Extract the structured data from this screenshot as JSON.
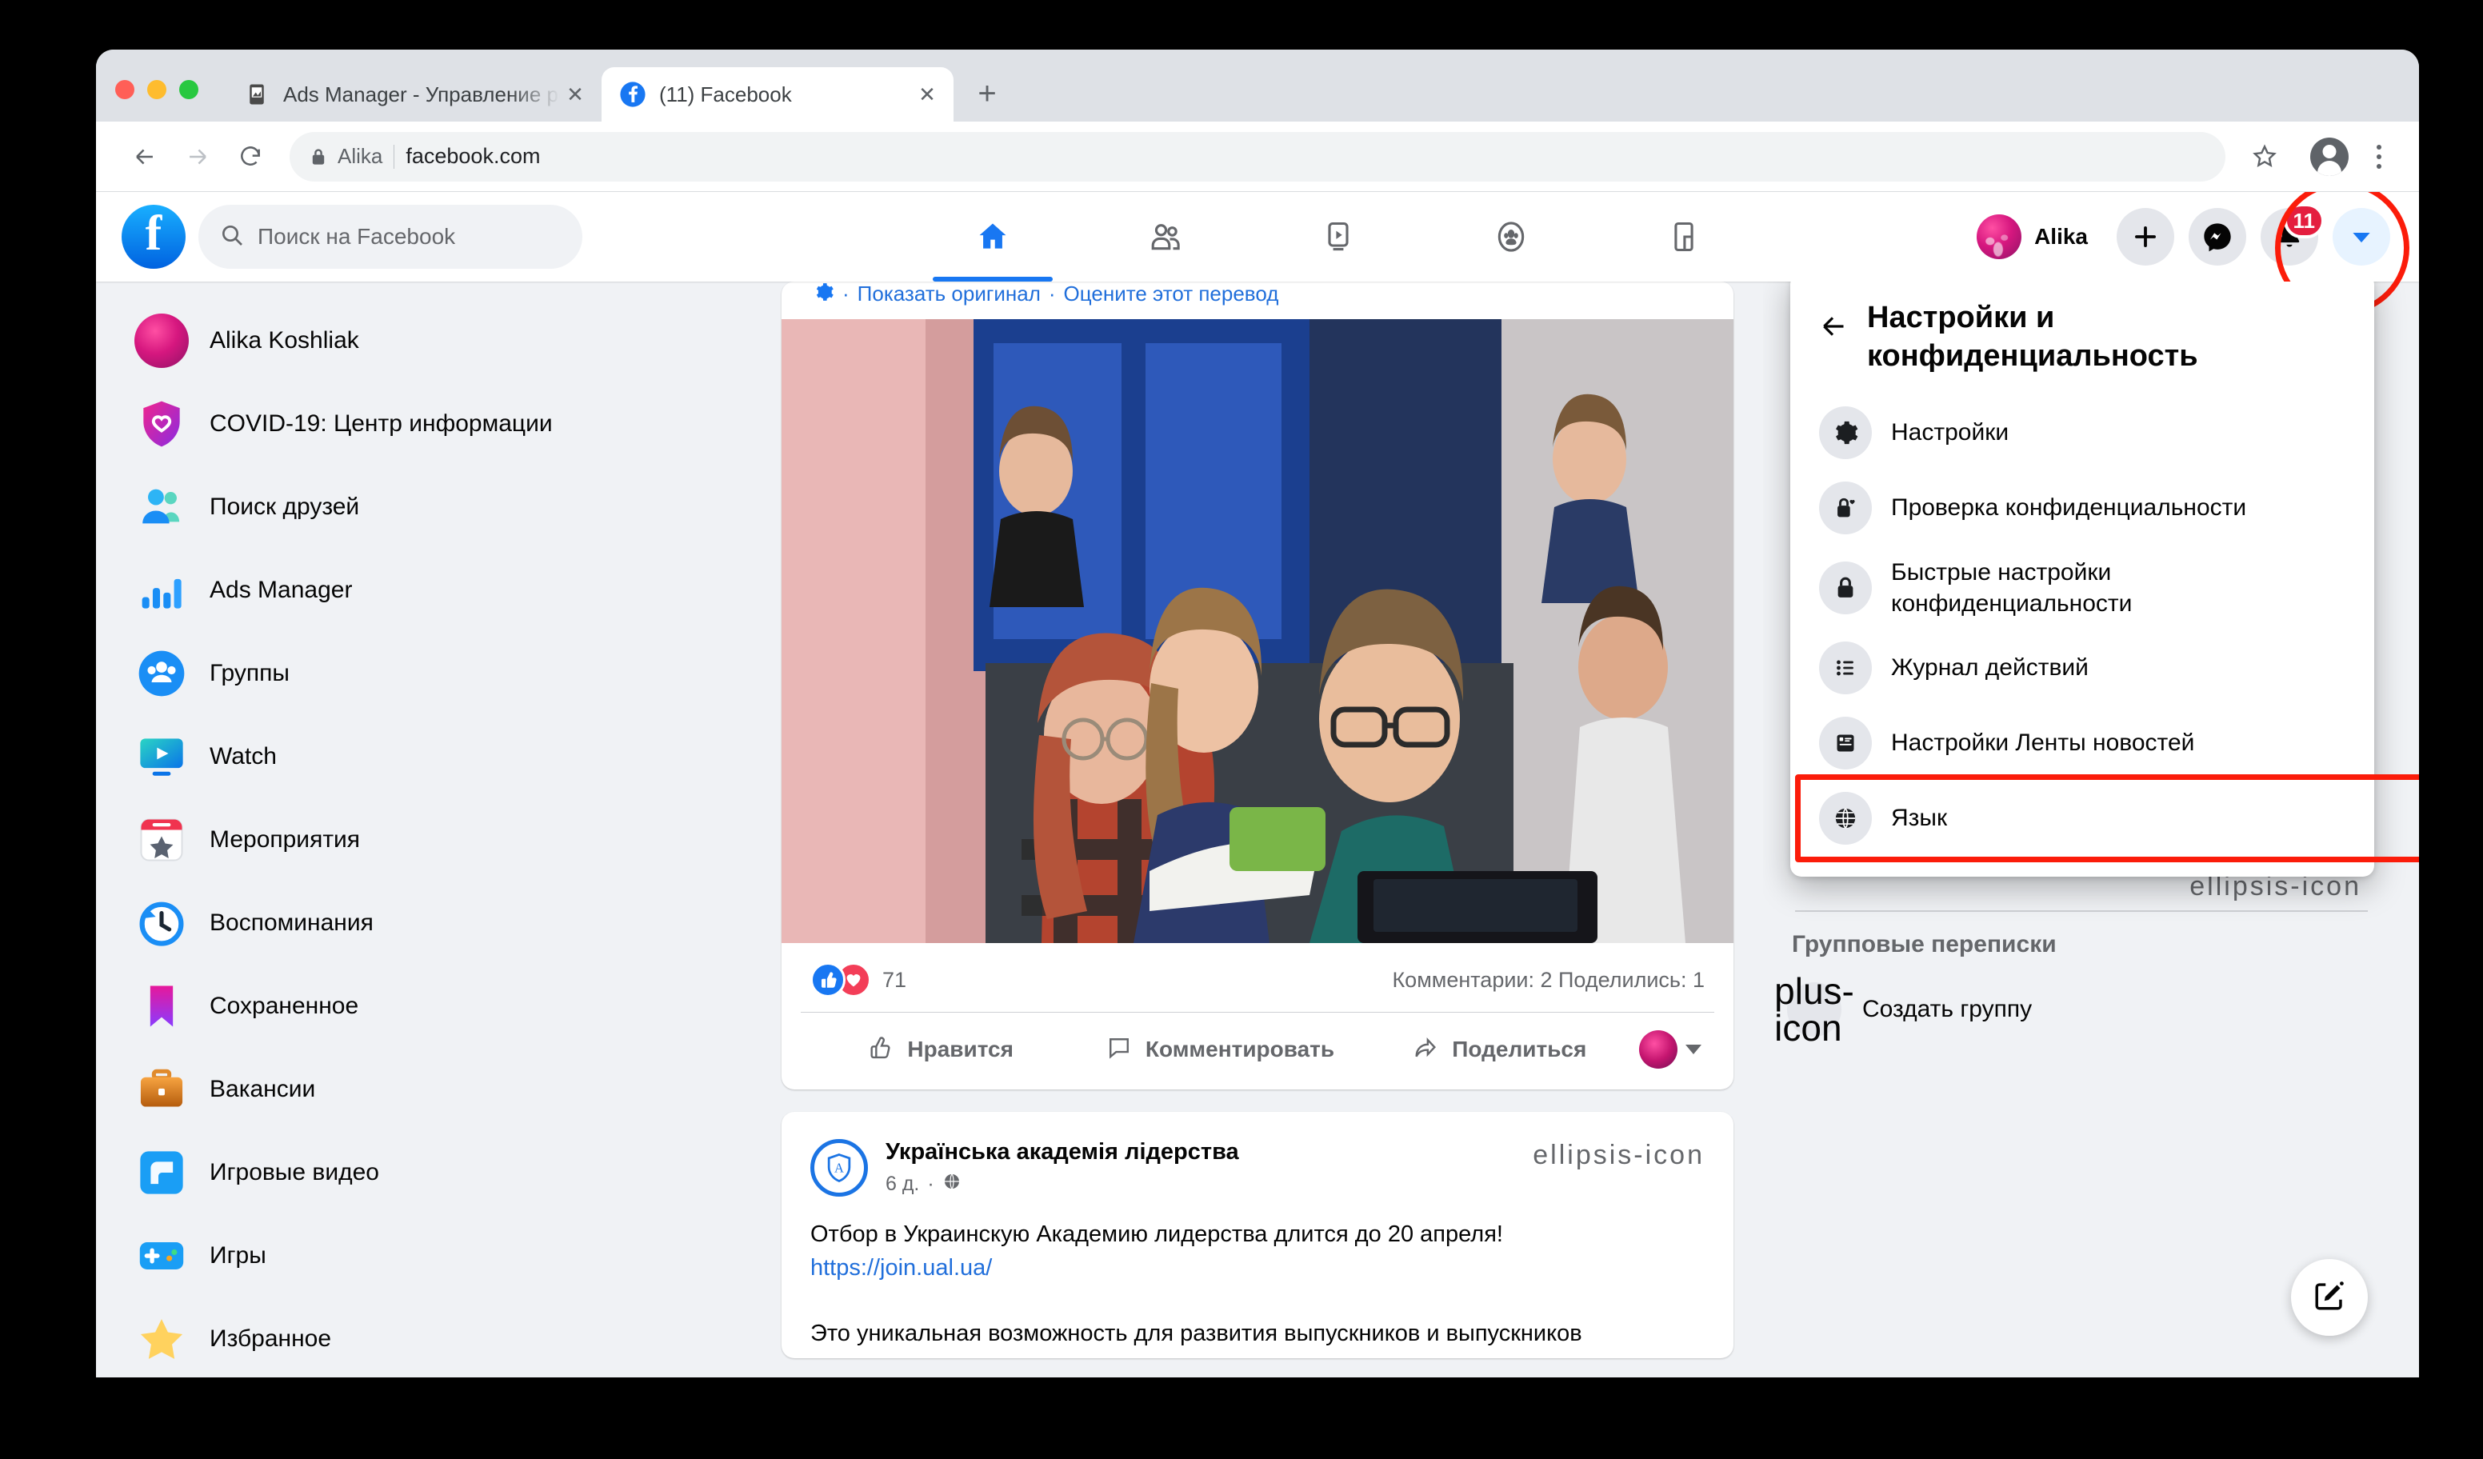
{
  "browser": {
    "tabs": [
      {
        "title": "Ads Manager - Управление ре",
        "favicon": "ads-manager-icon",
        "active": false
      },
      {
        "title": "(11) Facebook",
        "favicon": "facebook-icon",
        "active": true
      }
    ],
    "new_tab_label": "+",
    "close_label": "✕",
    "omnibox": {
      "user": "Alika",
      "url": "facebook.com",
      "lock_icon": "lock-icon"
    },
    "back_label": "←",
    "forward_label": "→",
    "reload_label": "⟳"
  },
  "fb_header": {
    "search_placeholder": "Поиск на Facebook",
    "logo_letter": "f",
    "nav": [
      {
        "name": "home",
        "icon": "home-icon",
        "active": true
      },
      {
        "name": "friends",
        "icon": "friends-icon",
        "active": false
      },
      {
        "name": "watch",
        "icon": "watch-icon",
        "active": false
      },
      {
        "name": "groups",
        "icon": "groups-icon",
        "active": false
      },
      {
        "name": "gaming",
        "icon": "gaming-icon",
        "active": false
      }
    ],
    "user_name": "Alika",
    "create_label": "+",
    "messenger_icon": "messenger-icon",
    "notifications_icon": "bell-icon",
    "notifications_badge": "11",
    "account_caret_icon": "caret-down-icon"
  },
  "sidebar": {
    "items": [
      {
        "label": "Alika Koshliak",
        "icon": "user-avatar-icon"
      },
      {
        "label": "COVID-19: Центр информации",
        "icon": "covid-shield-icon"
      },
      {
        "label": "Поиск друзей",
        "icon": "find-friends-icon"
      },
      {
        "label": "Ads Manager",
        "icon": "ads-manager-icon"
      },
      {
        "label": "Группы",
        "icon": "groups-icon"
      },
      {
        "label": "Watch",
        "icon": "watch-icon"
      },
      {
        "label": "Мероприятия",
        "icon": "events-icon"
      },
      {
        "label": "Воспоминания",
        "icon": "memories-icon"
      },
      {
        "label": "Сохраненное",
        "icon": "saved-icon"
      },
      {
        "label": "Вакансии",
        "icon": "jobs-icon"
      },
      {
        "label": "Игровые видео",
        "icon": "game-videos-icon"
      },
      {
        "label": "Игры",
        "icon": "games-icon"
      },
      {
        "label": "Избранное",
        "icon": "favorites-star-icon"
      }
    ]
  },
  "feed": {
    "post1": {
      "translate_gear_icon": "gear-icon",
      "translate_dot": "·",
      "show_original": "Показать оригинал",
      "rate_translation": "Оцените этот перевод",
      "reaction_count": "71",
      "comments_shares": "Комментарии: 2  Поделились: 1",
      "actions": [
        {
          "label": "Нравится",
          "icon": "thumbs-up-icon"
        },
        {
          "label": "Комментировать",
          "icon": "comment-icon"
        },
        {
          "label": "Поделиться",
          "icon": "share-icon"
        }
      ]
    },
    "post2": {
      "page_name": "Українська академія лідерства",
      "page_initial": "A",
      "time": "6 д.",
      "meta_dot": "·",
      "privacy_icon": "globe-icon",
      "menu_icon": "ellipsis-icon",
      "line1": "Отбор в Украинскую Академию лидерства длится до 20 апреля!",
      "link": "https://join.ual.ua/",
      "line2": "Это уникальная возможность для развития выпускников и выпускников"
    }
  },
  "dropdown": {
    "back_icon": "arrow-left-icon",
    "title": "Настройки и конфиденциальность",
    "items": [
      {
        "label": "Настройки",
        "icon": "gear-icon",
        "highlighted": false
      },
      {
        "label": "Проверка конфиденциальности",
        "icon": "lock-heart-icon",
        "highlighted": false
      },
      {
        "label": "Быстрые настройки конфиденциальности",
        "icon": "lock-icon",
        "highlighted": false
      },
      {
        "label": "Журнал действий",
        "icon": "list-icon",
        "highlighted": false
      },
      {
        "label": "Настройки Ленты новостей",
        "icon": "newsfeed-icon",
        "highlighted": false
      },
      {
        "label": "Язык",
        "icon": "globe-icon",
        "highlighted": true
      }
    ]
  },
  "right_rail": {
    "section_title": "Групповые переписки",
    "create_group_label": "Создать группу",
    "create_group_icon": "plus-icon",
    "hidden_menu_icon": "ellipsis-icon"
  },
  "fab": {
    "icon": "compose-icon"
  },
  "colors": {
    "fb_blue": "#1877f2",
    "annotation_red": "#fb1c0a",
    "badge_red": "#e41e3f",
    "page_bg": "#f0f2f5"
  }
}
